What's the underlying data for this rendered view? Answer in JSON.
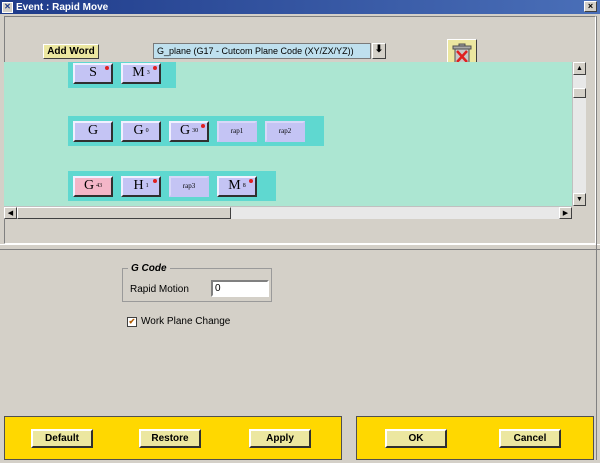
{
  "window": {
    "title": "Event : Rapid Move",
    "close_glyph": "×",
    "app_glyph": "✕"
  },
  "toolbar": {
    "add_word_label": "Add Word",
    "word_combo_value": "G_plane (G17 - Cutcom Plane Code (XY/ZX/YZ))",
    "combo_arrow_glyph": "⬇",
    "trash_icon": "trash-icon"
  },
  "canvas": {
    "background": "#ace6d2",
    "row_color": "#5fd8d0",
    "rows": [
      {
        "words": [
          {
            "letter": "S",
            "sup": "",
            "dot": true,
            "style": "normal"
          },
          {
            "letter": "M",
            "sup": "3",
            "dot": true,
            "style": "normal"
          }
        ]
      },
      {
        "words": [
          {
            "letter": "G",
            "sup": "",
            "dot": false,
            "style": "normal"
          },
          {
            "letter": "G",
            "sup": "0",
            "dot": false,
            "style": "normal"
          },
          {
            "letter": "G",
            "sup": "30",
            "dot": true,
            "style": "normal"
          },
          {
            "letter": "rap1",
            "sup": "",
            "dot": false,
            "style": "mini"
          },
          {
            "letter": "rap2",
            "sup": "",
            "dot": false,
            "style": "mini"
          }
        ]
      },
      {
        "words": [
          {
            "letter": "G",
            "sup": "43",
            "dot": false,
            "style": "pink"
          },
          {
            "letter": "H",
            "sup": "1",
            "dot": true,
            "style": "normal"
          },
          {
            "letter": "rap3",
            "sup": "",
            "dot": false,
            "style": "mini"
          },
          {
            "letter": "M",
            "sup": "8",
            "dot": true,
            "style": "normal"
          }
        ]
      }
    ]
  },
  "gcode_group": {
    "title": "G Code",
    "rapid_motion_label": "Rapid Motion",
    "rapid_motion_value": "0",
    "work_plane_change_label": "Work Plane Change",
    "work_plane_change_checked": true
  },
  "buttons": {
    "default_label": "Default",
    "restore_label": "Restore",
    "apply_label": "Apply",
    "ok_label": "OK",
    "cancel_label": "Cancel"
  },
  "scroll": {
    "up": "▲",
    "down": "▼",
    "left": "◀",
    "right": "▶"
  }
}
